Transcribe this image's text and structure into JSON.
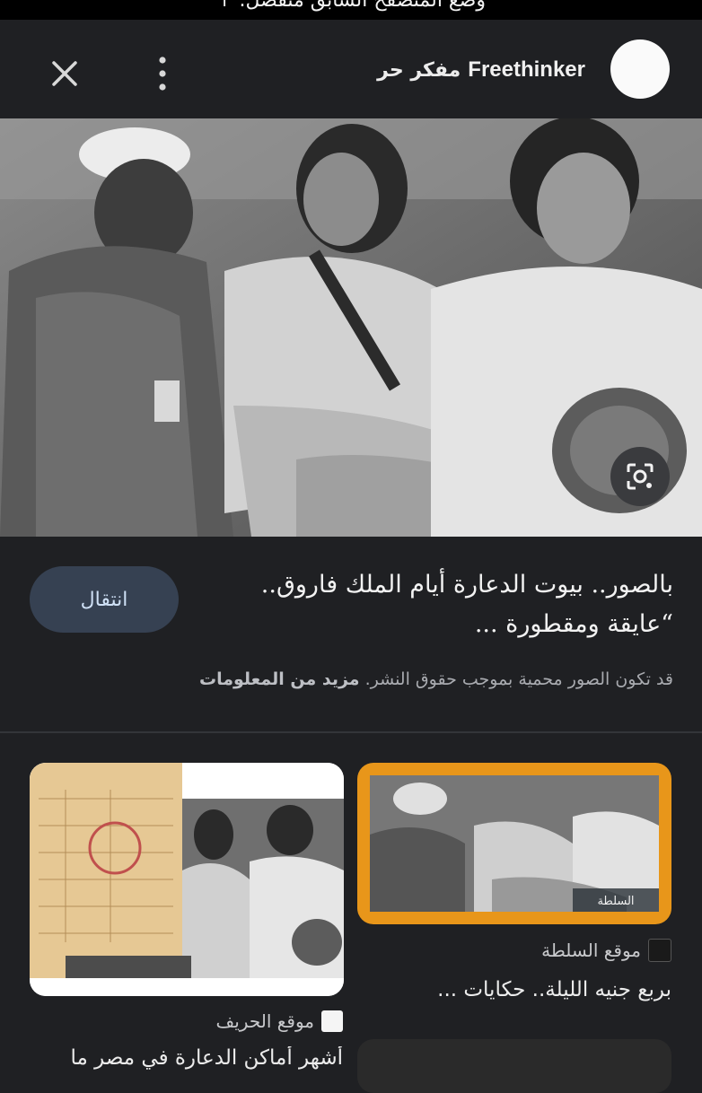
{
  "top_strip": {
    "text": "وضع المتصفح السابق منفصل. ↑"
  },
  "header": {
    "site_name_en": "Freethinker",
    "site_name_ar": "مفكر حر"
  },
  "hero": {
    "alt": "black and white photo"
  },
  "main": {
    "headline": "بالصور.. بيوت الدعارة أيام الملك فاروق.. “عايقة ومقطورة ...",
    "visit_button": "انتقال",
    "copyright_text": "قد تكون الصور محمية بموجب حقوق النشر.",
    "more_info": "مزيد من المعلومات"
  },
  "related": [
    {
      "source": "موقع السلطة",
      "title": "بربع جنيه الليلة.. حكايات ...",
      "watermark": "السلطة"
    },
    {
      "source": "موقع الحريف",
      "title": "أشهر أماكن الدعارة في مصر ما"
    }
  ],
  "colors": {
    "background": "#1f2023",
    "button_bg": "#364152",
    "button_text": "#cfe0f5",
    "card_frame": "#e8961a"
  }
}
